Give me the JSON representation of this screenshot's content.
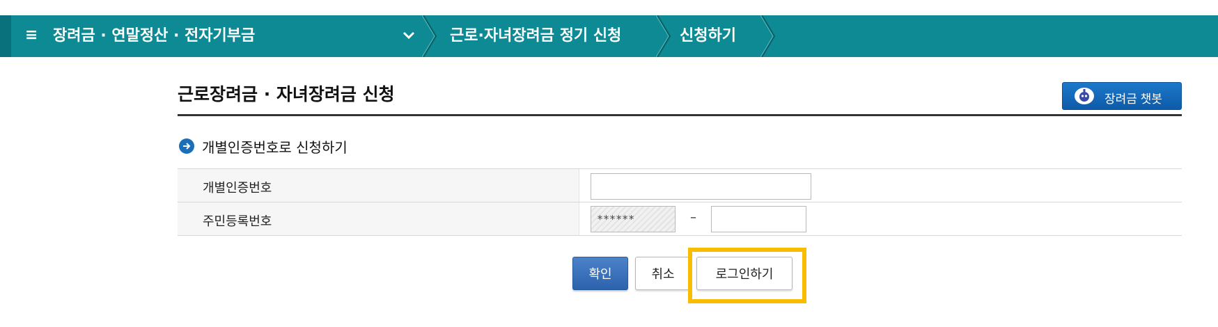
{
  "nav": {
    "category": "장려금 · 연말정산 · 전자기부금",
    "section": "근로·자녀장려금 정기 신청",
    "current": "신청하기"
  },
  "page": {
    "title": "근로장려금 · 자녀장려금 신청",
    "chatbot_label": "장려금 챗봇"
  },
  "section": {
    "title": "개별인증번호로 신청하기"
  },
  "form": {
    "auth_number_label": "개별인증번호",
    "auth_number_value": "",
    "rrn_label": "주민등록번호",
    "rrn_front_value": "******",
    "rrn_separator": "–",
    "rrn_back_value": ""
  },
  "buttons": {
    "confirm": "확인",
    "cancel": "취소",
    "login": "로그인하기"
  },
  "colors": {
    "nav_bg": "#0e8a95",
    "primary_button": "#2d62ad",
    "highlight": "#f9bd00"
  }
}
